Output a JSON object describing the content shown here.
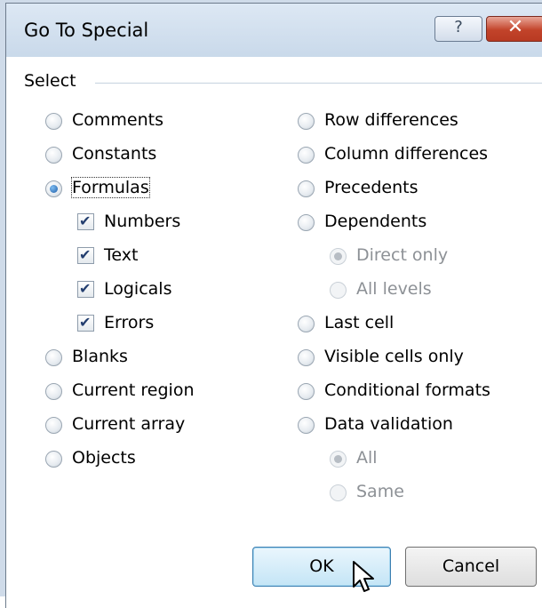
{
  "dialog": {
    "title": "Go To Special",
    "help_button": "?",
    "close_button": "✕",
    "group_label": "Select"
  },
  "left_column": [
    {
      "label": "Comments",
      "type": "radio",
      "checked": false
    },
    {
      "label": "Constants",
      "type": "radio",
      "checked": false
    },
    {
      "label": "Formulas",
      "type": "radio",
      "checked": true
    },
    {
      "label": "Numbers",
      "type": "checkbox",
      "checked": true
    },
    {
      "label": "Text",
      "type": "checkbox",
      "checked": true
    },
    {
      "label": "Logicals",
      "type": "checkbox",
      "checked": true
    },
    {
      "label": "Errors",
      "type": "checkbox",
      "checked": true
    },
    {
      "label": "Blanks",
      "type": "radio",
      "checked": false
    },
    {
      "label": "Current region",
      "type": "radio",
      "checked": false
    },
    {
      "label": "Current array",
      "type": "radio",
      "checked": false
    },
    {
      "label": "Objects",
      "type": "radio",
      "checked": false
    }
  ],
  "right_column": [
    {
      "label": "Row differences",
      "type": "radio",
      "checked": false
    },
    {
      "label": "Column differences",
      "type": "radio",
      "checked": false
    },
    {
      "label": "Precedents",
      "type": "radio",
      "checked": false
    },
    {
      "label": "Dependents",
      "type": "radio",
      "checked": false
    },
    {
      "label": "Direct only",
      "type": "radio",
      "checked": true,
      "disabled": true
    },
    {
      "label": "All levels",
      "type": "radio",
      "checked": false,
      "disabled": true
    },
    {
      "label": "Last cell",
      "type": "radio",
      "checked": false
    },
    {
      "label": "Visible cells only",
      "type": "radio",
      "checked": false
    },
    {
      "label": "Conditional formats",
      "type": "radio",
      "checked": false
    },
    {
      "label": "Data validation",
      "type": "radio",
      "checked": false
    },
    {
      "label": "All",
      "type": "radio",
      "checked": true,
      "disabled": true
    },
    {
      "label": "Same",
      "type": "radio",
      "checked": false,
      "disabled": true
    }
  ],
  "buttons": {
    "ok": "OK",
    "cancel": "Cancel"
  },
  "colors": {
    "title_bar": "#c9d9ea",
    "close_button": "#c2432a",
    "checkmark": "#233e6f",
    "disabled_text": "#8d9196"
  }
}
